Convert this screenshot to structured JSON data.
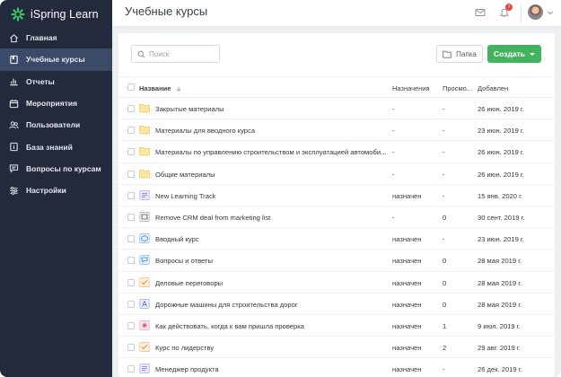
{
  "app": {
    "brand": "iSpring Learn",
    "page_title": "Учебные курсы",
    "notification_count": "7"
  },
  "colors": {
    "sidebar_bg": "#222a3b",
    "sidebar_active": "#3b4a67",
    "accent_green": "#44b35f",
    "badge_red": "#e64646"
  },
  "sidebar": {
    "items": [
      {
        "label": "Главная",
        "icon": "home-icon"
      },
      {
        "label": "Учебные курсы",
        "icon": "book-icon",
        "active": true
      },
      {
        "label": "Отчеты",
        "icon": "bar-chart-icon"
      },
      {
        "label": "Мероприятия",
        "icon": "calendar-icon"
      },
      {
        "label": "Пользователи",
        "icon": "users-icon"
      },
      {
        "label": "База знаний",
        "icon": "info-book-icon"
      },
      {
        "label": "Вопросы по курсам",
        "icon": "chat-icon"
      },
      {
        "label": "Настройки",
        "icon": "sliders-icon"
      }
    ]
  },
  "toolbar": {
    "search_placeholder": "Поиск",
    "folder_label": "Папка",
    "create_label": "Создать"
  },
  "table": {
    "columns": [
      "Название",
      "Назначения",
      "Просмо...",
      "Добавлен"
    ],
    "rows": [
      {
        "name": "Закрытые материалы",
        "assign": "-",
        "views": "-",
        "date": "26 июн. 2019 г.",
        "type": "folder"
      },
      {
        "name": "Материалы для вводного курса",
        "assign": "-",
        "views": "-",
        "date": "23 июн. 2019 г.",
        "type": "folder"
      },
      {
        "name": "Материалы по управлению строительством и эксплуатацией автомоби...",
        "assign": "-",
        "views": "-",
        "date": "26 июн. 2019 г.",
        "type": "folder"
      },
      {
        "name": "Общие материалы",
        "assign": "-",
        "views": "-",
        "date": "26 июн. 2019 г.",
        "type": "folder"
      },
      {
        "name": "New Learning Track",
        "assign": "назначен",
        "views": "-",
        "date": "15 янв. 2020 г.",
        "type": "track"
      },
      {
        "name": "Remove CRM deal from marketing list",
        "assign": "-",
        "views": "0",
        "date": "30 сент. 2019 г.",
        "type": "video"
      },
      {
        "name": "Вводный курс",
        "assign": "назначен",
        "views": "-",
        "date": "23 июн. 2019 г.",
        "type": "course"
      },
      {
        "name": "Вопросы и ответы",
        "assign": "назначен",
        "views": "0",
        "date": "28 мая 2019 г.",
        "type": "qa"
      },
      {
        "name": "Деловые переговоры",
        "assign": "назначен",
        "views": "0",
        "date": "28 мая 2019 г.",
        "type": "quiz"
      },
      {
        "name": "Дорожные машины для строительства дорог",
        "assign": "назначен",
        "views": "0",
        "date": "28 мая 2019 г.",
        "type": "doc"
      },
      {
        "name": "Как действовать, когда к вам пришла проверка",
        "assign": "назначен",
        "views": "1",
        "date": "9 июл. 2019 г.",
        "type": "interaction"
      },
      {
        "name": "Курс по лидерству",
        "assign": "назначен",
        "views": "2",
        "date": "29 авг. 2019 г.",
        "type": "quiz"
      },
      {
        "name": "Менеджер продукта",
        "assign": "назначен",
        "views": "-",
        "date": "26 дек. 2019 г.",
        "type": "track"
      }
    ]
  }
}
